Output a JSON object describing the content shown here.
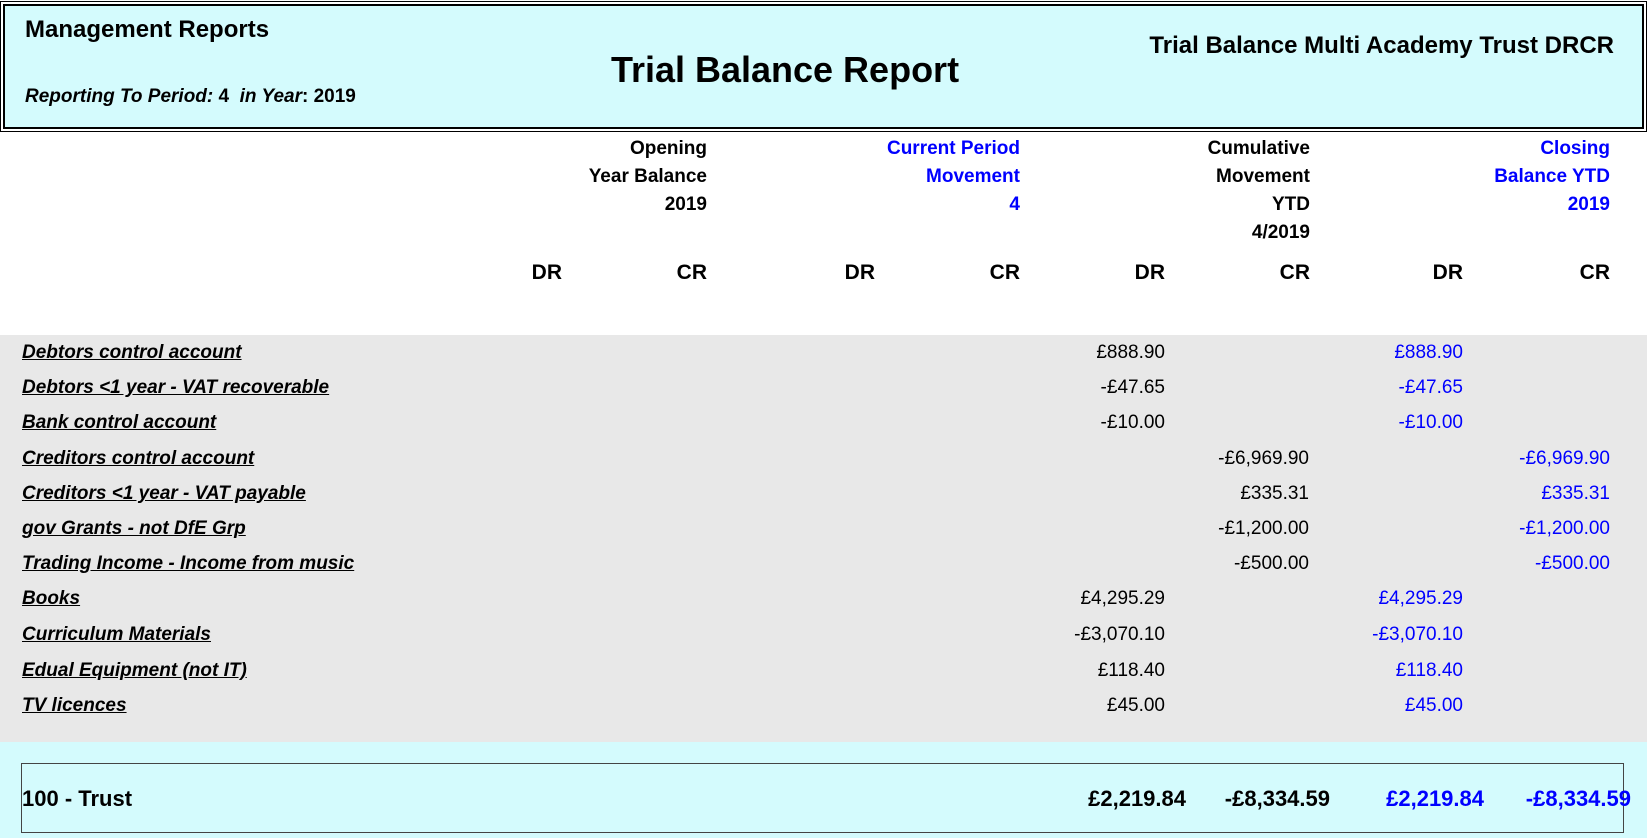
{
  "header": {
    "left_title": "Management Reports",
    "period_label": "Reporting To Period:",
    "period_value": "4",
    "year_label": "in Year",
    "year_value": "2019",
    "report_title": "Trial Balance Report",
    "entity_title": "Trial Balance Multi Academy Trust DRCR"
  },
  "columns": {
    "opening": [
      "Opening",
      "Year Balance",
      "2019"
    ],
    "current": [
      "Current Period",
      "Movement",
      "4"
    ],
    "cumulative": [
      "Cumulative",
      "Movement",
      "YTD",
      "4/2019"
    ],
    "closing": [
      "Closing",
      "Balance YTD",
      "2019"
    ],
    "dr": "DR",
    "cr": "CR"
  },
  "colors": {
    "accent_blue": "#0000ff",
    "header_bg": "#d4fbfd",
    "body_bg": "#e8e8e8"
  },
  "rows": [
    {
      "label": "Debtors control account",
      "cum_dr": "£888.90",
      "cum_cr": "",
      "close_dr": "£888.90",
      "close_cr": ""
    },
    {
      "label": "Debtors <1 year - VAT recoverable",
      "cum_dr": "-£47.65",
      "cum_cr": "",
      "close_dr": "-£47.65",
      "close_cr": ""
    },
    {
      "label": "Bank control account",
      "cum_dr": "-£10.00",
      "cum_cr": "",
      "close_dr": "-£10.00",
      "close_cr": ""
    },
    {
      "label": "Creditors control account",
      "cum_dr": "",
      "cum_cr": "-£6,969.90",
      "close_dr": "",
      "close_cr": "-£6,969.90"
    },
    {
      "label": "Creditors <1 year - VAT payable",
      "cum_dr": "",
      "cum_cr": "£335.31",
      "close_dr": "",
      "close_cr": "£335.31"
    },
    {
      "label": "gov Grants - not DfE Grp",
      "cum_dr": "",
      "cum_cr": "-£1,200.00",
      "close_dr": "",
      "close_cr": "-£1,200.00"
    },
    {
      "label": "Trading Income - Income from music",
      "cum_dr": "",
      "cum_cr": "-£500.00",
      "close_dr": "",
      "close_cr": "-£500.00"
    },
    {
      "label": "Books",
      "cum_dr": "£4,295.29",
      "cum_cr": "",
      "close_dr": "£4,295.29",
      "close_cr": ""
    },
    {
      "label": "Curriculum Materials",
      "cum_dr": "-£3,070.10",
      "cum_cr": "",
      "close_dr": "-£3,070.10",
      "close_cr": ""
    },
    {
      "label": "Edual Equipment (not IT)",
      "cum_dr": "£118.40",
      "cum_cr": "",
      "close_dr": "£118.40",
      "close_cr": ""
    },
    {
      "label": "TV licences",
      "cum_dr": "£45.00",
      "cum_cr": "",
      "close_dr": "£45.00",
      "close_cr": ""
    }
  ],
  "total": {
    "label": "100 - Trust",
    "cum_dr": "£2,219.84",
    "cum_cr": "-£8,334.59",
    "close_dr": "£2,219.84",
    "close_cr": "-£8,334.59"
  }
}
